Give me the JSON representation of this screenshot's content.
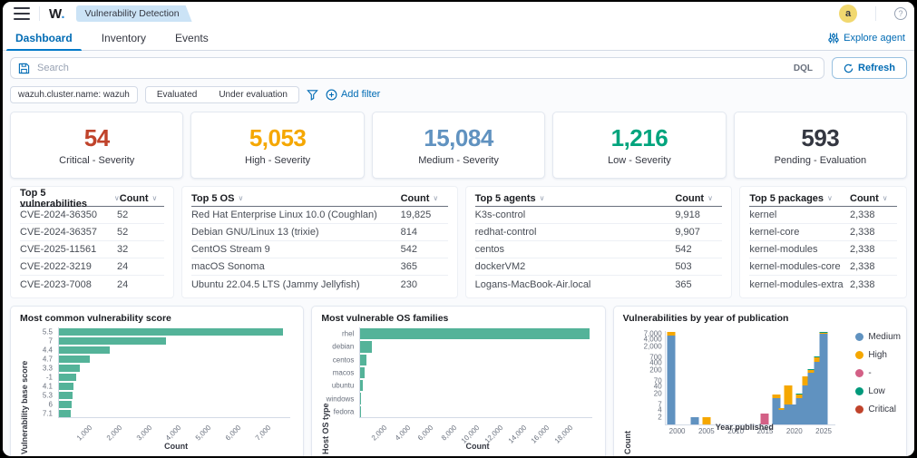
{
  "topbar": {
    "logo_w": "W",
    "logo_dot": ".",
    "breadcrumb": "Vulnerability Detection",
    "avatar_initial": "a",
    "help": "?"
  },
  "tabs": [
    {
      "label": "Dashboard",
      "active": true
    },
    {
      "label": "Inventory",
      "active": false
    },
    {
      "label": "Events",
      "active": false
    }
  ],
  "explore_agent_label": "Explore agent",
  "search": {
    "placeholder": "Search",
    "language_button": "DQL",
    "refresh_label": "Refresh"
  },
  "filters": {
    "pill_cluster": "wazuh.cluster.name: wazuh",
    "pill_evaluated": "Evaluated",
    "pill_under_evaluation": "Under evaluation",
    "add_filter_label": "Add filter"
  },
  "stats": [
    {
      "value": "54",
      "label": "Critical - Severity",
      "color": "#C0432B"
    },
    {
      "value": "5,053",
      "label": "High - Severity",
      "color": "#F5A700"
    },
    {
      "value": "15,084",
      "label": "Medium - Severity",
      "color": "#6092C0"
    },
    {
      "value": "1,216",
      "label": "Low - Severity",
      "color": "#00A47D"
    },
    {
      "value": "593",
      "label": "Pending - Evaluation",
      "color": "#343741"
    }
  ],
  "tables": [
    {
      "title": "Top 5 vulnerabilities",
      "count_header": "Count",
      "rows": [
        [
          "CVE-2024-36350",
          "52"
        ],
        [
          "CVE-2024-36357",
          "52"
        ],
        [
          "CVE-2025-11561",
          "32"
        ],
        [
          "CVE-2022-3219",
          "24"
        ],
        [
          "CVE-2023-7008",
          "24"
        ]
      ]
    },
    {
      "title": "Top 5 OS",
      "count_header": "Count",
      "rows": [
        [
          "Red Hat Enterprise Linux 10.0 (Coughlan)",
          "19,825"
        ],
        [
          "Debian GNU/Linux 13 (trixie)",
          "814"
        ],
        [
          "CentOS Stream 9",
          "542"
        ],
        [
          "macOS Sonoma",
          "365"
        ],
        [
          "Ubuntu 22.04.5 LTS (Jammy Jellyfish)",
          "230"
        ]
      ]
    },
    {
      "title": "Top 5 agents",
      "count_header": "Count",
      "rows": [
        [
          "K3s-control",
          "9,918"
        ],
        [
          "redhat-control",
          "9,907"
        ],
        [
          "centos",
          "542"
        ],
        [
          "dockerVM2",
          "503"
        ],
        [
          "Logans-MacBook-Air.local",
          "365"
        ]
      ]
    },
    {
      "title": "Top 5 packages",
      "count_header": "Count",
      "rows": [
        [
          "kernel",
          "2,338"
        ],
        [
          "kernel-core",
          "2,338"
        ],
        [
          "kernel-modules",
          "2,338"
        ],
        [
          "kernel-modules-core",
          "2,338"
        ],
        [
          "kernel-modules-extra",
          "2,338"
        ]
      ]
    }
  ],
  "chart_data": [
    {
      "type": "bar",
      "orientation": "horizontal",
      "title": "Most common vulnerability score",
      "xlabel": "Count",
      "ylabel": "Vulnerability base score",
      "categories": [
        "5.5",
        "7",
        "4.4",
        "4.7",
        "3.3",
        "-1",
        "4.1",
        "5.3",
        "6",
        "7.1"
      ],
      "values": [
        7550,
        3600,
        1700,
        1050,
        700,
        580,
        500,
        460,
        420,
        410
      ],
      "xlim": [
        0,
        7800
      ],
      "xticks": [
        1000,
        2000,
        3000,
        4000,
        5000,
        6000,
        7000
      ],
      "bar_color": "#54B399",
      "grid": false
    },
    {
      "type": "bar",
      "orientation": "horizontal",
      "title": "Most vulnerable OS families",
      "xlabel": "Count",
      "ylabel": "Host OS type",
      "categories": [
        "rhel",
        "debian",
        "centos",
        "macos",
        "ubuntu",
        "windows",
        "fedora"
      ],
      "values": [
        19825,
        1000,
        550,
        380,
        230,
        15,
        8
      ],
      "xlim": [
        0,
        20000
      ],
      "xticks": [
        2000,
        4000,
        6000,
        8000,
        10000,
        12000,
        14000,
        16000,
        18000
      ],
      "bar_color": "#54B399",
      "grid": false
    },
    {
      "type": "bar",
      "stacked": true,
      "log_scale": true,
      "title": "Vulnerabilities by year of publication",
      "xlabel": "Year published",
      "ylabel": "Count",
      "xlim": [
        1998,
        2027
      ],
      "xticks": [
        2000,
        2005,
        2010,
        2015,
        2020,
        2025
      ],
      "ylim": [
        1,
        10000
      ],
      "yticks": [
        2,
        4,
        7,
        20,
        40,
        70,
        200,
        400,
        700,
        2000,
        4000,
        7000
      ],
      "legend_position": "right",
      "series": [
        {
          "name": "Medium",
          "color": "#6092C0"
        },
        {
          "name": "High",
          "color": "#F5A700"
        },
        {
          "name": "-",
          "color": "#D36086"
        },
        {
          "name": "Low",
          "color": "#00997B"
        },
        {
          "name": "Critical",
          "color": "#C0432B"
        }
      ],
      "bars": [
        {
          "year": 1999,
          "values": {
            "Medium": 6000,
            "High": 2500
          }
        },
        {
          "year": 2003,
          "values": {
            "Medium": 2
          }
        },
        {
          "year": 2005,
          "values": {
            "High": 2
          }
        },
        {
          "year": 2015,
          "values": {
            "-": 3
          }
        },
        {
          "year": 2017,
          "values": {
            "Medium": 13,
            "High": 5
          }
        },
        {
          "year": 2018,
          "values": {
            "Medium": 4,
            "High": 1
          }
        },
        {
          "year": 2019,
          "values": {
            "Medium": 7,
            "High": 38
          }
        },
        {
          "year": 2020,
          "values": {
            "Medium": 7
          }
        },
        {
          "year": 2021,
          "values": {
            "Medium": 13,
            "High": 5,
            "Low": 3
          }
        },
        {
          "year": 2022,
          "values": {
            "Medium": 45,
            "High": 65
          }
        },
        {
          "year": 2023,
          "values": {
            "Medium": 150,
            "High": 60,
            "Low": 20
          }
        },
        {
          "year": 2024,
          "values": {
            "Medium": 450,
            "High": 250,
            "Low": 80
          }
        },
        {
          "year": 2025,
          "values": {
            "Medium": 7200,
            "High": 800,
            "Low": 200
          }
        }
      ]
    }
  ]
}
